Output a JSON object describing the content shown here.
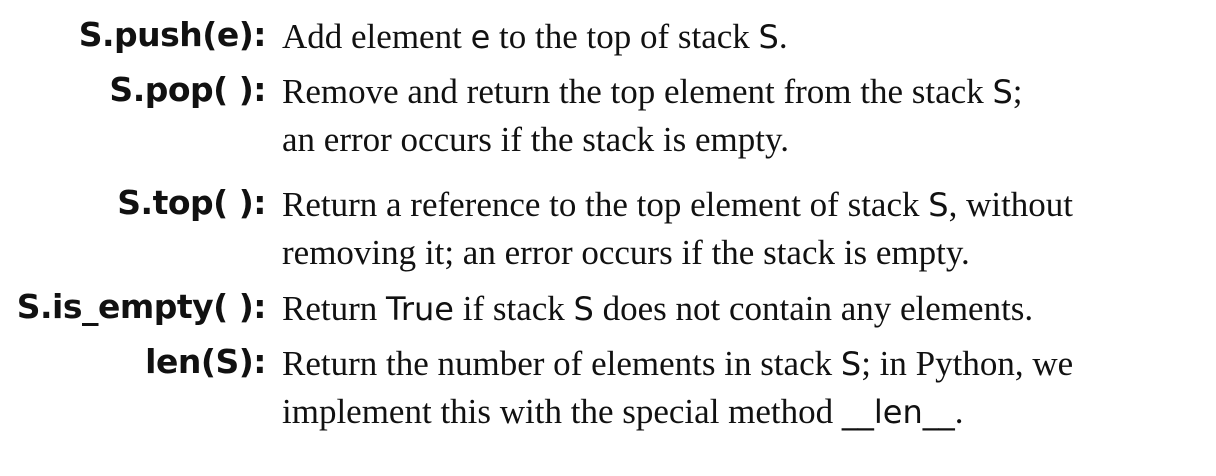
{
  "entries": [
    {
      "term": "S.push(e):",
      "lines": [
        [
          "Add element ",
          "e",
          " to the top of stack ",
          "S",
          "."
        ]
      ]
    },
    {
      "term": "S.pop( ):",
      "lines": [
        [
          "Remove and return the top element from the stack ",
          "S",
          ";"
        ],
        [
          "an error occurs if the stack is empty."
        ]
      ]
    },
    {
      "term": "S.top( ):",
      "lines": [
        [
          "Return a reference to the top element of stack ",
          "S",
          ", without"
        ],
        [
          "removing it; an error occurs if the stack is empty."
        ]
      ]
    },
    {
      "term": "S.is_empty( ):",
      "lines": [
        [
          "Return ",
          "True",
          " if stack ",
          "S",
          " does not contain any elements."
        ]
      ]
    },
    {
      "term": "len(S):",
      "lines": [
        [
          "Return the number of elements in stack ",
          "S",
          "; in Python, we"
        ],
        [
          "implement this with the special method ",
          "__len__",
          "."
        ]
      ]
    }
  ]
}
